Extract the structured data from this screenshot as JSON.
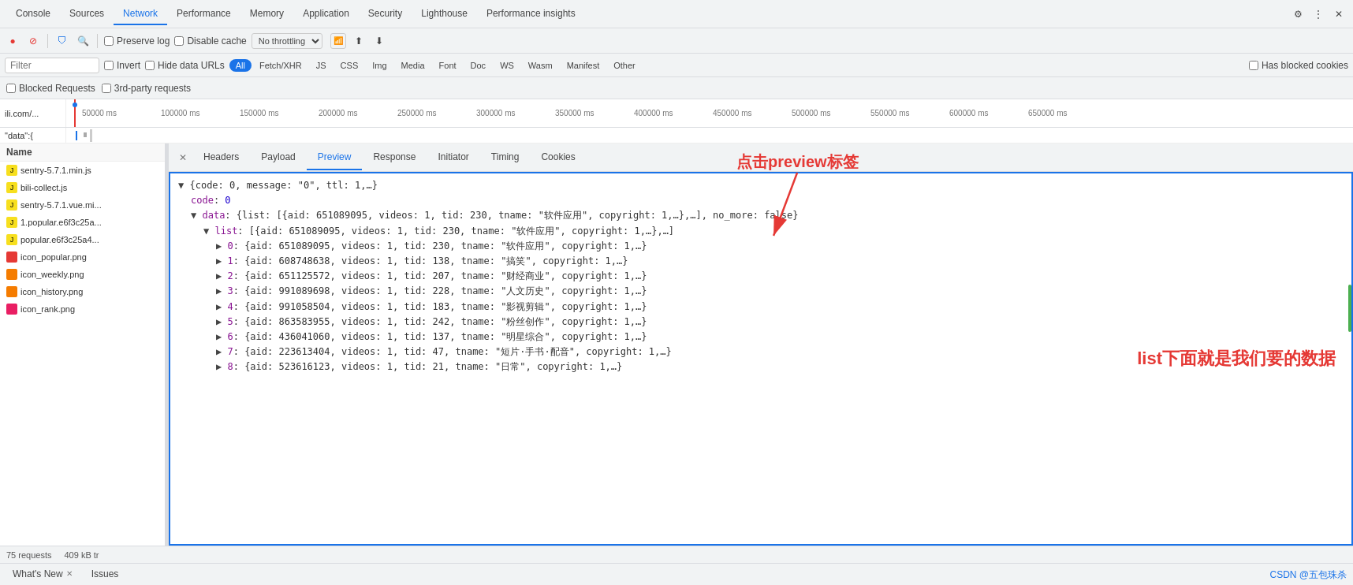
{
  "tabs": {
    "items": [
      "Console",
      "Sources",
      "Network",
      "Performance",
      "Memory",
      "Application",
      "Security",
      "Lighthouse",
      "Performance insights"
    ]
  },
  "toolbar": {
    "preserveLog": "Preserve log",
    "disableCache": "Disable cache",
    "throttling": "No throttling",
    "upload_label": "↑",
    "download_label": "↓"
  },
  "filter": {
    "placeholder": "Filter",
    "invert": "Invert",
    "hideDataUrls": "Hide data URLs",
    "tags": [
      "All",
      "Fetch/XHR",
      "JS",
      "CSS",
      "Img",
      "Media",
      "Font",
      "Doc",
      "WS",
      "Wasm",
      "Manifest",
      "Other"
    ],
    "activeTag": "All",
    "hasBlockedCookies": "Has blocked cookies"
  },
  "blocked": {
    "blockedRequests": "Blocked Requests",
    "thirdParty": "3rd-party requests"
  },
  "timeline": {
    "labels": [
      "50000 ms",
      "100000 ms",
      "150000 ms",
      "200000 ms",
      "250000 ms",
      "300000 ms",
      "350000 ms",
      "400000 ms",
      "450000 ms",
      "500000 ms",
      "550000 ms",
      "600000 ms",
      "650000 ms"
    ]
  },
  "fileList": {
    "header": "Name",
    "items": [
      {
        "name": "sentry-5.7.1.min.js",
        "iconType": "js"
      },
      {
        "name": "bili-collect.js",
        "iconType": "js"
      },
      {
        "name": "sentry-5.7.1.vue.mi...",
        "iconType": "js"
      },
      {
        "name": "1.popular.e6f3c25a...",
        "iconType": "js"
      },
      {
        "name": "popular.e6f3c25a4...",
        "iconType": "js"
      },
      {
        "name": "icon_popular.png",
        "iconType": "png-red"
      },
      {
        "name": "icon_weekly.png",
        "iconType": "png-orange"
      },
      {
        "name": "icon_history.png",
        "iconType": "png-orange"
      },
      {
        "name": "icon_rank.png",
        "iconType": "png-pink"
      }
    ]
  },
  "urlBar": {
    "text": "ili.com/..."
  },
  "dataBar": {
    "text": "\"data\":{"
  },
  "subTabs": {
    "items": [
      "Headers",
      "Payload",
      "Preview",
      "Response",
      "Initiator",
      "Timing",
      "Cookies"
    ],
    "active": "Preview"
  },
  "preview": {
    "rootLine": "{code: 0, message: \"0\", ttl: 1,…}",
    "codeLine": "code: 0",
    "dataLine": "data: {list: [{aid: 651089095, videos: 1, tid: 230, tname: \"软件应用\", copyright: 1,…},…], no_more: false}",
    "listLine": "list: [{aid: 651089095, videos: 1, tid: 230, tname: \"软件应用\", copyright: 1,…},…]",
    "items": [
      {
        "index": "0",
        "text": "{aid: 651089095, videos: 1, tid: 230, tname: \"软件应用\", copyright: 1,…}"
      },
      {
        "index": "1",
        "text": "{aid: 608748638, videos: 1, tid: 138, tname: \"搞笑\", copyright: 1,…}"
      },
      {
        "index": "2",
        "text": "{aid: 651125572, videos: 1, tid: 207, tname: \"财经商业\", copyright: 1,…}"
      },
      {
        "index": "3",
        "text": "{aid: 991089698, videos: 1, tid: 228, tname: \"人文历史\", copyright: 1,…}"
      },
      {
        "index": "4",
        "text": "{aid: 991058504, videos: 1, tid: 183, tname: \"影视剪辑\", copyright: 1,…}"
      },
      {
        "index": "5",
        "text": "{aid: 863583955, videos: 1, tid: 242, tname: \"粉丝创作\", copyright: 1,…}"
      },
      {
        "index": "6",
        "text": "{aid: 436041060, videos: 1, tid: 137, tname: \"明星综合\", copyright: 1,…}"
      },
      {
        "index": "7",
        "text": "{aid: 223613404, videos: 1, tid: 47, tname: \"短片·手书·配音\", copyright: 1,…}"
      },
      {
        "index": "8",
        "text": "{aid: 523616123, videos: 1, tid: 21, tname: \"日常\", copyright: 1,…}"
      }
    ]
  },
  "statusBar": {
    "requests": "75 requests",
    "size": "409 kB tr"
  },
  "bottomTabs": {
    "items": [
      {
        "label": "What's New",
        "closeable": true
      },
      {
        "label": "Issues",
        "closeable": false
      }
    ]
  },
  "annotations": {
    "arrowText": "点击preview标签",
    "listText": "list下面就是我们要的数据"
  },
  "watermark": "CSDN @五包珠杀"
}
